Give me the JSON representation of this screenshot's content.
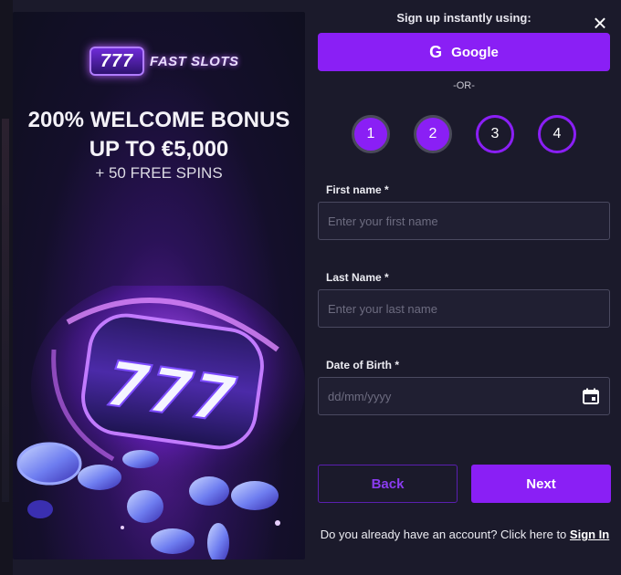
{
  "promo": {
    "logo_number": "777",
    "logo_text": "FAST SLOTS",
    "bonus_line1": "200% WELCOME BONUS",
    "bonus_line2": "UP TO €5,000",
    "bonus_line3": "+ 50 FREE SPINS",
    "art_digits": "777"
  },
  "signup": {
    "instant_text": "Sign up instantly using:",
    "google_label": "Google",
    "google_icon_glyph": "G",
    "or_text": "-OR-",
    "close_glyph": "×",
    "steps": [
      {
        "label": "1",
        "state": "done"
      },
      {
        "label": "2",
        "state": "done"
      },
      {
        "label": "3",
        "state": "todo"
      },
      {
        "label": "4",
        "state": "todo"
      }
    ],
    "first_name": {
      "label": "First name *",
      "placeholder": "Enter your first name",
      "value": ""
    },
    "last_name": {
      "label": "Last Name *",
      "placeholder": "Enter your last name",
      "value": ""
    },
    "dob": {
      "label": "Date of Birth *",
      "placeholder": "dd/mm/yyyy",
      "value": ""
    },
    "back_label": "Back",
    "next_label": "Next",
    "account_prompt": "Do you already have an account? Click here to ",
    "signin_label": "Sign In"
  },
  "colors": {
    "accent": "#8a1ff5",
    "background": "#1b1a2b",
    "input_bg": "#201f32"
  }
}
